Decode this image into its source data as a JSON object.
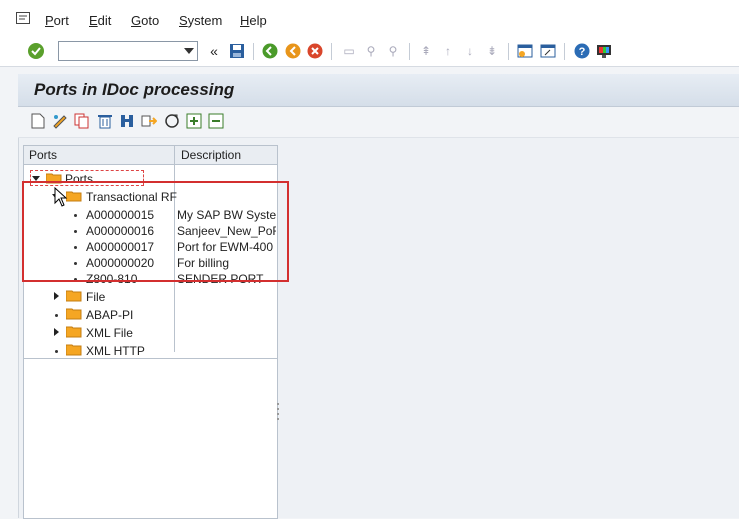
{
  "menu": {
    "items": [
      {
        "label": "Port",
        "accel": "P"
      },
      {
        "label": "Edit",
        "accel": "E"
      },
      {
        "label": "Goto",
        "accel": "G"
      },
      {
        "label": "System",
        "accel": "S"
      },
      {
        "label": "Help",
        "accel": "H"
      }
    ]
  },
  "toolbar": {
    "command_field_value": "",
    "icons": [
      "enter-icon",
      "command-field",
      "back-double-icon",
      "save-icon",
      "back-icon",
      "exit-icon",
      "cancel-icon",
      "print-icon",
      "find-icon",
      "find-next-icon",
      "first-page-icon",
      "previous-page-icon",
      "next-page-icon",
      "last-page-icon",
      "create-session-icon",
      "shortcut-icon",
      "help-icon",
      "customize-layout-icon"
    ]
  },
  "page": {
    "title": "Ports in IDoc processing"
  },
  "app_toolbar": {
    "icons": [
      "create-icon",
      "change-icon",
      "copy-icon",
      "delete-icon",
      "find-icon",
      "transfer-icon",
      "refresh-icon",
      "expand-icon",
      "collapse-icon"
    ]
  },
  "tree": {
    "col_ports": "Ports",
    "col_description": "Description",
    "root": "Ports",
    "nodes": {
      "transactional": "Transactional RF",
      "ports": [
        {
          "name": "A000000015",
          "desc": "My SAP BW Syster"
        },
        {
          "name": "A000000016",
          "desc": "Sanjeev_New_PoF"
        },
        {
          "name": "A000000017",
          "desc": "Port for EWM-400"
        },
        {
          "name": "A000000020",
          "desc": "For billing"
        },
        {
          "name": "Z800-810",
          "desc": "SENDER PORT"
        }
      ],
      "file": "File",
      "abap_pi": "ABAP-PI",
      "xml_file": "XML File",
      "xml_http": "XML HTTP"
    }
  },
  "colors": {
    "highlight": "#d32f2f",
    "folder": "#f5a623",
    "title_bg": "#dbe3ed"
  }
}
